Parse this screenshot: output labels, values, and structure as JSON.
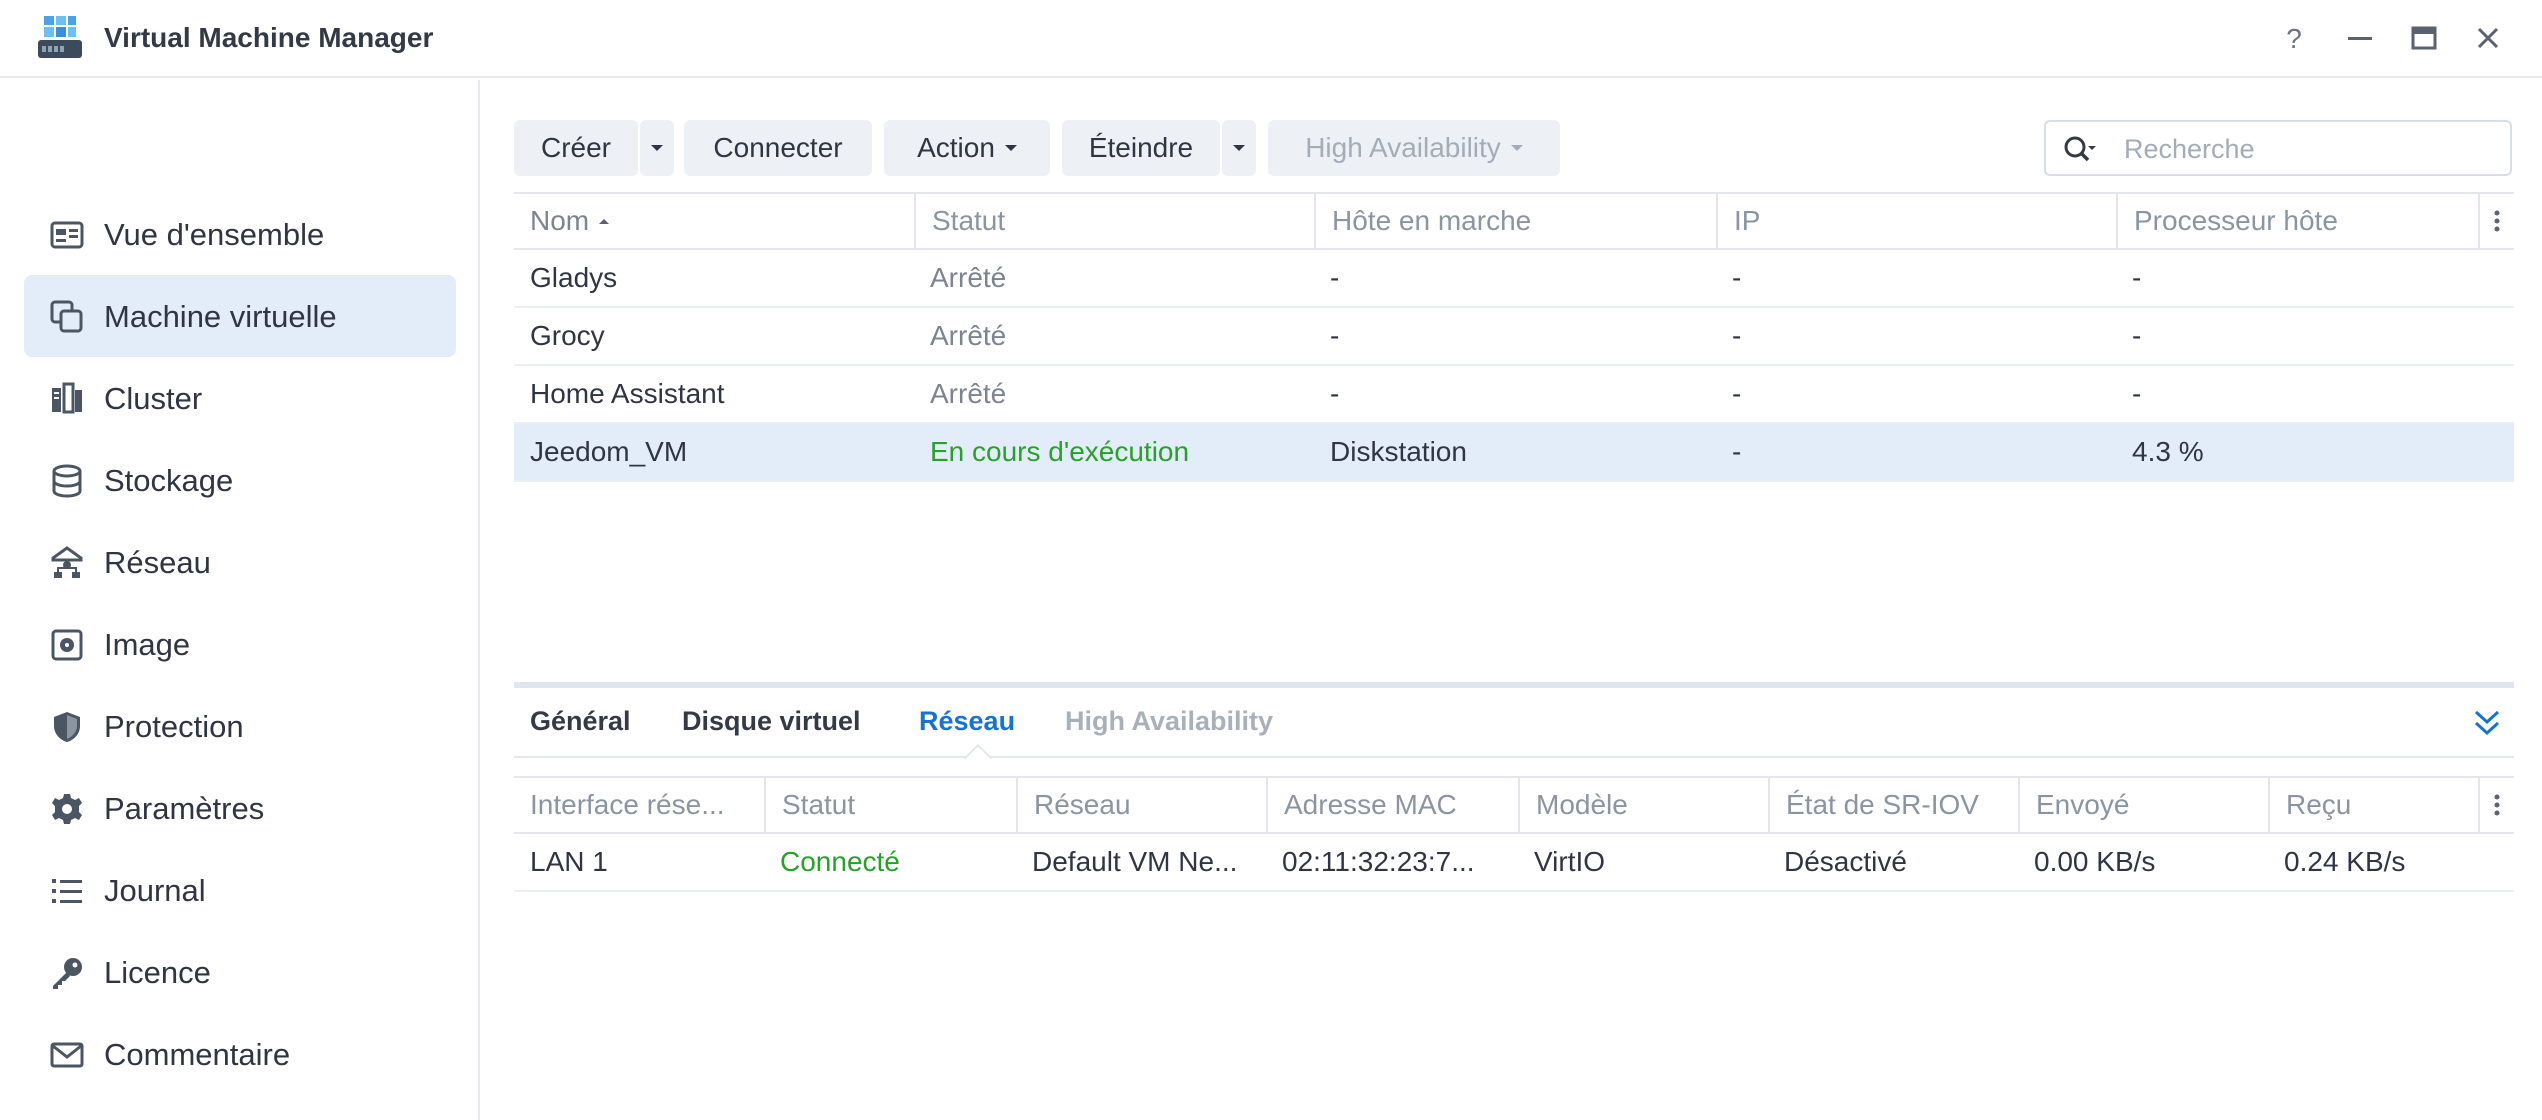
{
  "app": {
    "title": "Virtual Machine Manager"
  },
  "sidebar": {
    "items": [
      {
        "label": "Vue d'ensemble",
        "icon": "overview-icon",
        "active": false
      },
      {
        "label": "Machine virtuelle",
        "icon": "virtual-machine-icon",
        "active": true
      },
      {
        "label": "Cluster",
        "icon": "cluster-icon",
        "active": false
      },
      {
        "label": "Stockage",
        "icon": "storage-icon",
        "active": false
      },
      {
        "label": "Réseau",
        "icon": "network-icon",
        "active": false
      },
      {
        "label": "Image",
        "icon": "image-icon",
        "active": false
      },
      {
        "label": "Protection",
        "icon": "shield-icon",
        "active": false
      },
      {
        "label": "Paramètres",
        "icon": "gear-icon",
        "active": false
      },
      {
        "label": "Journal",
        "icon": "list-icon",
        "active": false
      },
      {
        "label": "Licence",
        "icon": "key-icon",
        "active": false
      },
      {
        "label": "Commentaire",
        "icon": "mail-icon",
        "active": false
      }
    ]
  },
  "toolbar": {
    "create": "Créer",
    "connect": "Connecter",
    "action": "Action",
    "shutdown": "Éteindre",
    "high_availability": "High Availability",
    "search_placeholder": "Recherche"
  },
  "vm_table": {
    "columns": [
      "Nom",
      "Statut",
      "Hôte en marche",
      "IP",
      "Processeur hôte"
    ],
    "rows": [
      {
        "name": "Gladys",
        "status": "Arrêté",
        "host": "-",
        "ip": "-",
        "cpu": "-"
      },
      {
        "name": "Grocy",
        "status": "Arrêté",
        "host": "-",
        "ip": "-",
        "cpu": "-"
      },
      {
        "name": "Home Assistant",
        "status": "Arrêté",
        "host": "-",
        "ip": "-",
        "cpu": "-"
      },
      {
        "name": "Jeedom_VM",
        "status": "En cours d'exécution",
        "host": "Diskstation",
        "ip": "-",
        "cpu": "4.3 %"
      }
    ]
  },
  "detail": {
    "tabs": [
      "Général",
      "Disque virtuel",
      "Réseau",
      "High Availability"
    ],
    "active_tab": "Réseau",
    "columns": [
      "Interface rése...",
      "Statut",
      "Réseau",
      "Adresse MAC",
      "Modèle",
      "État de SR-IOV",
      "Envoyé",
      "Reçu"
    ],
    "rows": [
      {
        "interface": "LAN 1",
        "status": "Connecté",
        "network": "Default VM Ne...",
        "mac": "02:11:32:23:7...",
        "model": "VirtIO",
        "sriov": "Désactivé",
        "sent": "0.00 KB/s",
        "received": "0.24 KB/s"
      }
    ]
  },
  "colors": {
    "accent": "#1673d3",
    "running_green": "#27a12a",
    "selected_row": "#e3edf9",
    "button_bg": "#edf1f5"
  }
}
